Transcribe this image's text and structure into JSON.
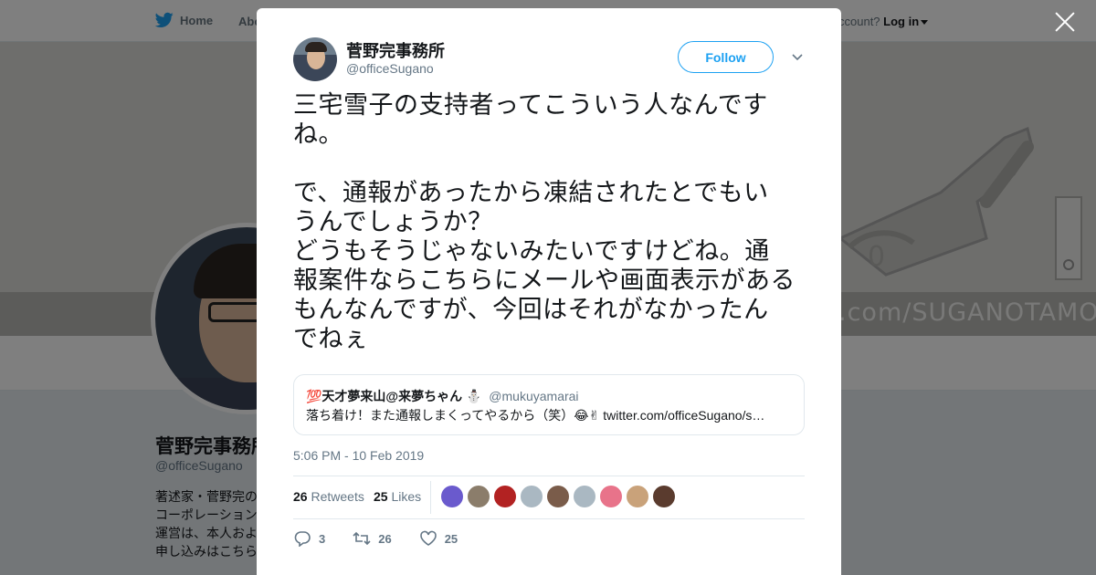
{
  "topnav": {
    "home_label": "Home",
    "about_label": "Abo",
    "login_prefix": "ccount? ",
    "login_label": "Log in"
  },
  "banner": {
    "text": ".com/SUGANOTAMOTSU"
  },
  "profile": {
    "name": "菅野完事務所",
    "handle": "@officeSugano",
    "bio_lines": [
      "著述家・菅野完の",
      "コーポレーション",
      "運営は、本人およ",
      "申し込みはこちら"
    ]
  },
  "tweet": {
    "author_name": "菅野完事務所",
    "author_handle": "@officeSugano",
    "follow_label": "Follow",
    "text": "三宅雪子の支持者ってこういう人なんです\nね。\n\nで、通報があったから凍結されたとでもい\nうんでしょうか？\nどうもそうじゃないみたいですけどね。通\n報案件ならこちらにメールや画面表示がある\nもんなんですが、今回はそれがなかったん\nでねぇ",
    "quote": {
      "name": "💯天才夢来山@来夢ちゃん ⛄",
      "handle": "@mukuyamarai",
      "text": "落ち着け！また通報しまくってやるから（笑）😂✌ twitter.com/officeSugano/s…"
    },
    "timestamp": "5:06 PM - 10 Feb 2019",
    "retweets_count": "26",
    "retweets_label": "Retweets",
    "likes_count": "25",
    "likes_label": "Likes",
    "liker_colors": [
      "#6a5acd",
      "#8b7d6b",
      "#b22222",
      "#aab8c2",
      "#7a5c4a",
      "#aab8c2",
      "#e8738a",
      "#c9a27a",
      "#5a3b2e"
    ],
    "actions": {
      "reply_count": "3",
      "retweet_count": "26",
      "like_count": "25"
    }
  }
}
